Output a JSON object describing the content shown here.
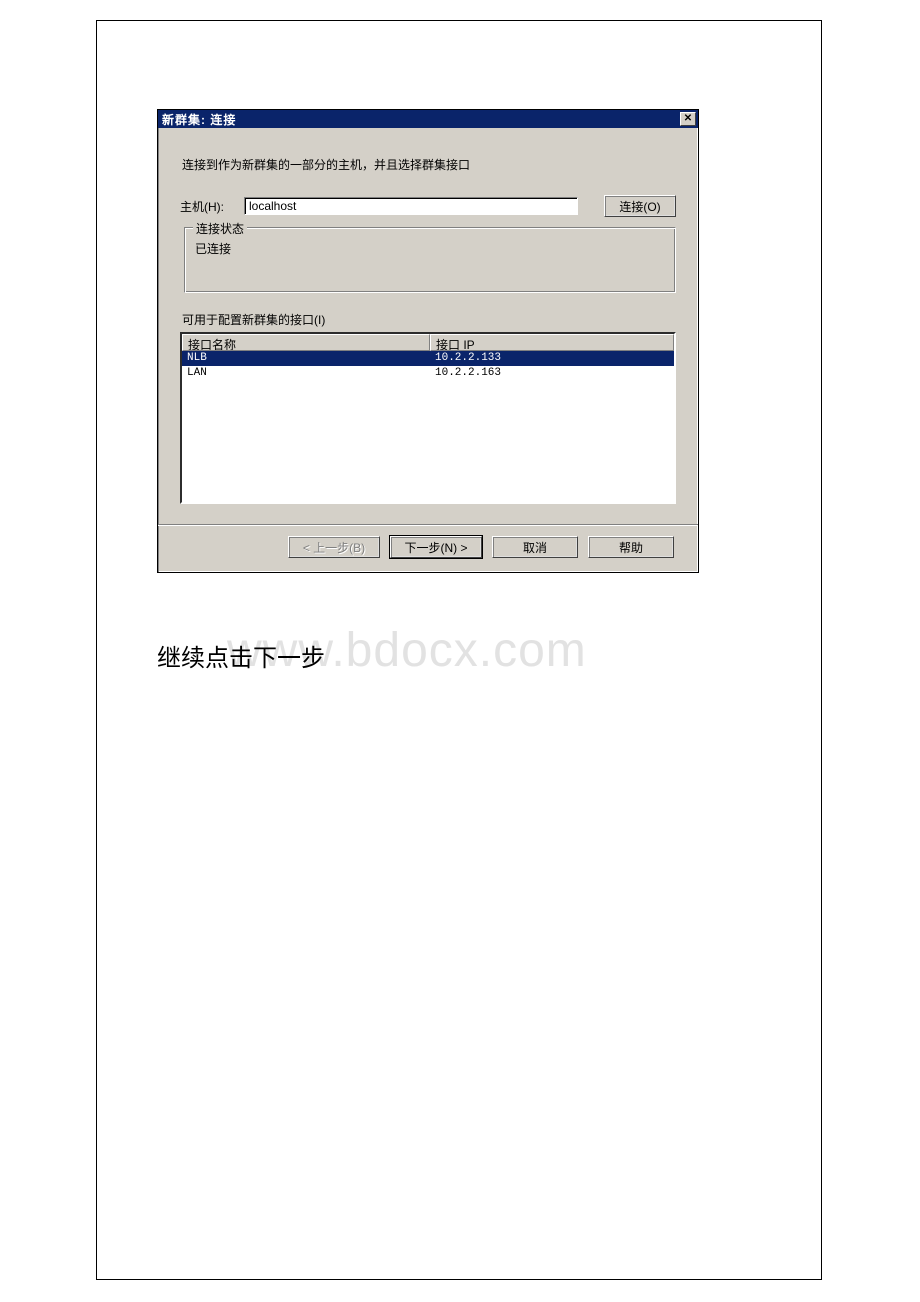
{
  "dialog": {
    "title": "新群集:  连接",
    "instruction": "连接到作为新群集的一部分的主机，并且选择群集接口",
    "host_label": "主机(H):",
    "host_value": "localhost",
    "connect_button": "连接(O)",
    "status_group": "连接状态",
    "status_text": "已连接",
    "available_label": "可用于配置新群集的接口(I)",
    "columns": {
      "name": "接口名称",
      "ip": "接口 IP"
    },
    "rows": [
      {
        "name": "NLB",
        "ip": "10.2.2.133",
        "selected": true
      },
      {
        "name": "LAN",
        "ip": "10.2.2.163",
        "selected": false
      }
    ],
    "buttons": {
      "back": "< 上一步(B)",
      "next": "下一步(N) >",
      "cancel": "取消",
      "help": "帮助"
    }
  },
  "caption": "继续点击下一步",
  "watermark": "www.bdocx.com"
}
